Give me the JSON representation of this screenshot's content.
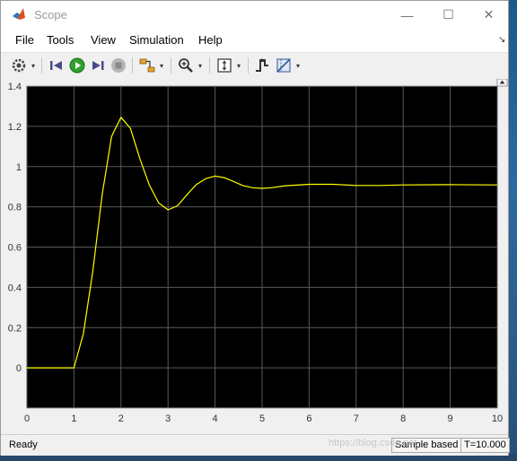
{
  "window": {
    "title": "Scope",
    "minimize_symbol": "—",
    "maximize_symbol": "☐",
    "close_symbol": "✕"
  },
  "menu": {
    "items": [
      "File",
      "Tools",
      "View",
      "Simulation",
      "Help"
    ],
    "overflow_symbol": "↘"
  },
  "toolbar": {
    "icons": [
      "configuration-properties-icon",
      "step-back-icon",
      "run-icon",
      "step-forward-icon",
      "stop-icon",
      "highlight-simulink-block-icon",
      "zoom-icon",
      "autoscale-icon",
      "triggers-icon",
      "cursor-measurements-icon"
    ],
    "dropdown_symbol": "▾"
  },
  "status": {
    "text": "Ready",
    "mode": "Sample based",
    "time": "T=10.000"
  },
  "watermark": "https://blog.csdn.net",
  "colors": {
    "plot_background": "#000000",
    "axes_background": "#f0f0f0",
    "grid": "#5a5a5a",
    "signal": "#ffff00",
    "run_button": "#2ea12e",
    "stop_button": "#9c9c9c"
  },
  "chart_data": {
    "type": "line",
    "title": "",
    "xlabel": "",
    "ylabel": "",
    "xlim": [
      0,
      10
    ],
    "ylim": [
      -0.2,
      1.4
    ],
    "grid": true,
    "x_ticks": [
      "0",
      "1",
      "2",
      "3",
      "4",
      "5",
      "6",
      "7",
      "8",
      "9",
      "10"
    ],
    "y_ticks": [
      "0",
      "0.2",
      "0.4",
      "0.6",
      "0.8",
      "1",
      "1.2",
      "1.4"
    ],
    "series": [
      {
        "color": "#ffff00",
        "x": [
          0,
          1.0,
          1.2,
          1.4,
          1.6,
          1.8,
          2.0,
          2.2,
          2.4,
          2.6,
          2.8,
          3.0,
          3.2,
          3.4,
          3.6,
          3.8,
          4.0,
          4.2,
          4.4,
          4.6,
          4.8,
          5.0,
          5.2,
          5.5,
          6.0,
          6.5,
          7.0,
          7.5,
          8.0,
          9.0,
          10.0
        ],
        "y": [
          0,
          0,
          0.17,
          0.48,
          0.86,
          1.15,
          1.245,
          1.19,
          1.04,
          0.91,
          0.82,
          0.785,
          0.805,
          0.86,
          0.91,
          0.94,
          0.953,
          0.945,
          0.925,
          0.905,
          0.895,
          0.892,
          0.895,
          0.905,
          0.912,
          0.912,
          0.906,
          0.906,
          0.909,
          0.91,
          0.909
        ]
      }
    ]
  }
}
